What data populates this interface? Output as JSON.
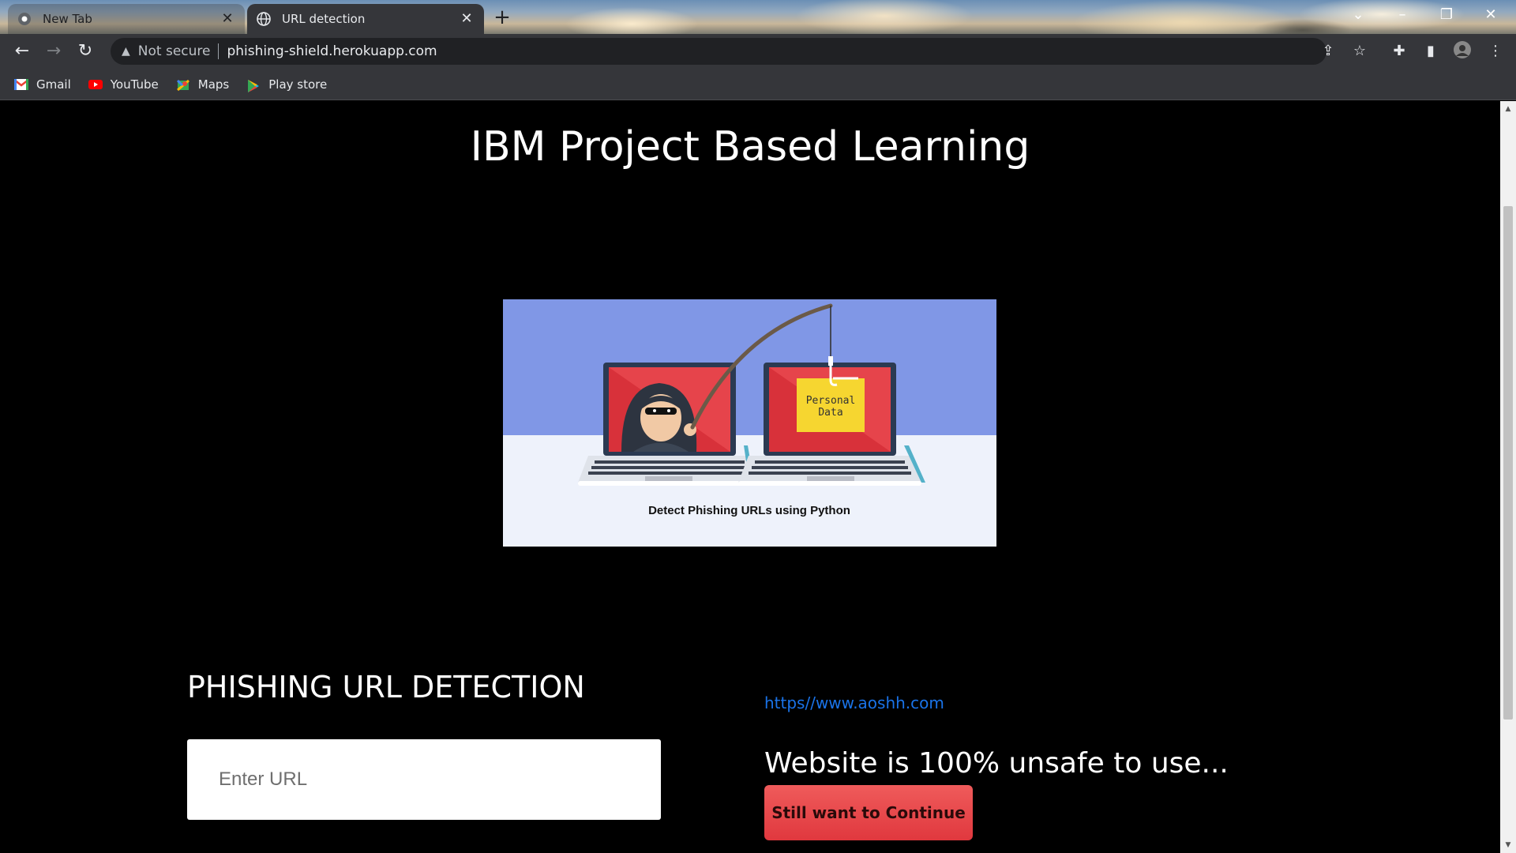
{
  "browser": {
    "tabs": [
      {
        "label": "New Tab",
        "active": false
      },
      {
        "label": "URL detection",
        "active": true
      }
    ],
    "address": {
      "security_label": "Not secure",
      "url": "phishing-shield.herokuapp.com"
    },
    "bookmarks": [
      {
        "label": "Gmail",
        "icon": "gmail-icon"
      },
      {
        "label": "YouTube",
        "icon": "youtube-icon"
      },
      {
        "label": "Maps",
        "icon": "maps-icon"
      },
      {
        "label": "Play store",
        "icon": "play-store-icon"
      }
    ]
  },
  "page": {
    "heading": "IBM Project Based Learning",
    "hero": {
      "caption": "Detect Phishing URLs using Python",
      "note_text_1": "Personal",
      "note_text_2": "Data"
    },
    "detector": {
      "title": "PHISHING URL DETECTION",
      "input_placeholder": "Enter URL"
    },
    "result": {
      "checked_url": "https//www.aoshh.com",
      "verdict": "Website is 100% unsafe to use...",
      "continue_label": "Still want to Continue"
    }
  },
  "colors": {
    "page_background": "#000000",
    "link": "#1a73e8",
    "button": "#e8454a",
    "hero_sky": "#8097e6"
  }
}
